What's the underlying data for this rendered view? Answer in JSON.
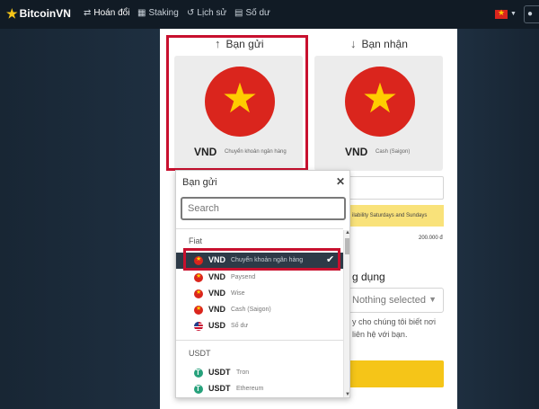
{
  "nav": {
    "logo": "BitcoinVN",
    "items": [
      {
        "label": "Hoán đổi",
        "icon": "swap-icon"
      },
      {
        "label": "Staking",
        "icon": "staking-icon"
      },
      {
        "label": "Lịch sử",
        "icon": "history-icon"
      },
      {
        "label": "Số dư",
        "icon": "wallet-icon"
      }
    ],
    "account_icon": "user-icon"
  },
  "send": {
    "title": "Bạn gửi",
    "currency": "VND",
    "method": "Chuyển khoản ngân hàng"
  },
  "receive": {
    "title": "Bạn nhận",
    "currency": "VND",
    "method": "Cash (Saigon)"
  },
  "right": {
    "note": "ilability Saturdays and Sundays",
    "amount": "200.000 đ",
    "section_label": "g dụng",
    "select_value": "Nothing selected",
    "help_line1": "y cho chúng tôi biết nơi",
    "help_line2": "liên hệ với bạn."
  },
  "dropdown": {
    "title": "Bạn gửi",
    "search_placeholder": "Search",
    "groups": [
      {
        "label": "Fiat",
        "items": [
          {
            "code": "VND",
            "method": "Chuyển khoản ngân hàng",
            "flag": "vn",
            "selected": true
          },
          {
            "code": "VND",
            "method": "Paysend",
            "flag": "vn"
          },
          {
            "code": "VND",
            "method": "Wise",
            "flag": "vn"
          },
          {
            "code": "VND",
            "method": "Cash (Saigon)",
            "flag": "vn"
          },
          {
            "code": "USD",
            "method": "Số dư",
            "flag": "us"
          }
        ]
      },
      {
        "label": "USDT",
        "items": [
          {
            "code": "USDT",
            "method": "Tron",
            "flag": "usdt"
          },
          {
            "code": "USDT",
            "method": "Ethereum",
            "flag": "usdt"
          }
        ]
      }
    ]
  },
  "colors": {
    "accent_yellow": "#f5c518",
    "highlight_red": "#c8102e",
    "selected_row": "#2d3a47",
    "vn_red": "#da251d",
    "vn_star": "#ffcd00"
  }
}
